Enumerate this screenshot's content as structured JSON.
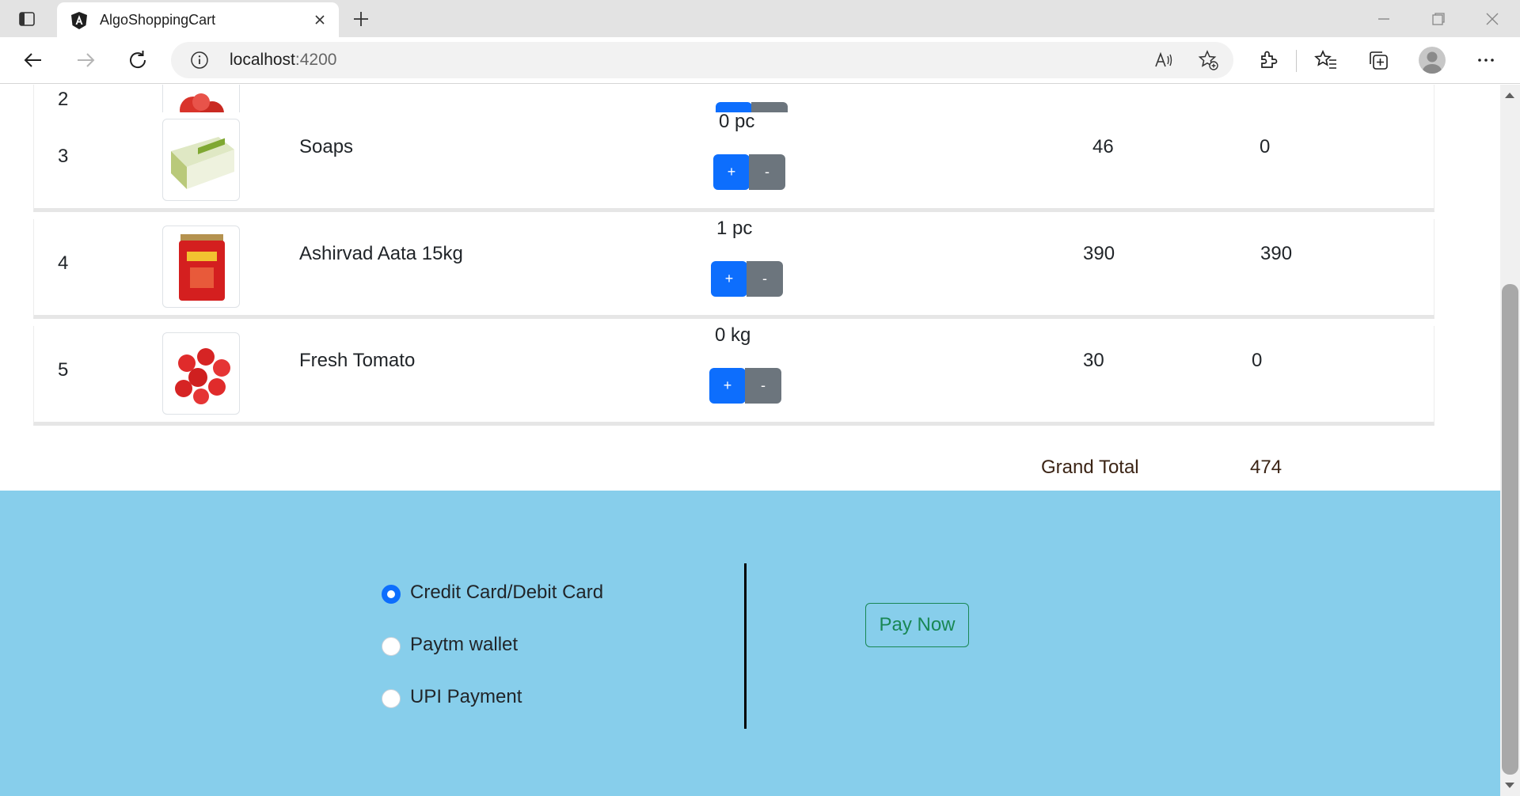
{
  "browser": {
    "tab_title": "AlgoShoppingCart",
    "url_host": "localhost",
    "url_port": ":4200"
  },
  "cart": {
    "rows": [
      {
        "num": "2",
        "name": "",
        "qty": "",
        "price": "",
        "total": "",
        "plus": "+",
        "minus": "-"
      },
      {
        "num": "3",
        "name": "Soaps",
        "qty": "0 pc",
        "price": "46",
        "total": "0",
        "plus": "+",
        "minus": "-"
      },
      {
        "num": "4",
        "name": "Ashirvad Aata 15kg",
        "qty": "1 pc",
        "price": "390",
        "total": "390",
        "plus": "+",
        "minus": "-"
      },
      {
        "num": "5",
        "name": "Fresh Tomato",
        "qty": "0 kg",
        "price": "30",
        "total": "0",
        "plus": "+",
        "minus": "-"
      }
    ],
    "grand_total_label": "Grand Total",
    "grand_total_value": "474"
  },
  "payment": {
    "options": [
      {
        "label": "Credit Card/Debit Card",
        "checked": true
      },
      {
        "label": "Paytm wallet",
        "checked": false
      },
      {
        "label": "UPI Payment",
        "checked": false
      }
    ],
    "pay_button": "Pay Now"
  },
  "colors": {
    "primary": "#0d6efd",
    "secondary": "#6c757d",
    "payment_bg": "#87ceeb",
    "success": "#198754"
  }
}
